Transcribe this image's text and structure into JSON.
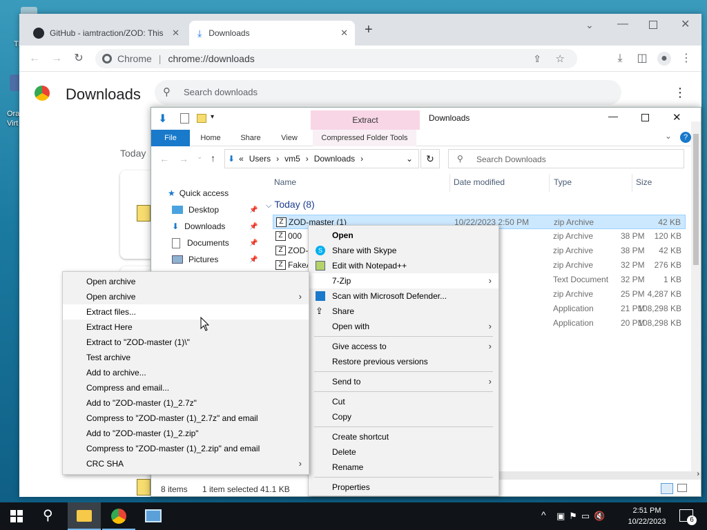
{
  "desktop": {
    "icon1_label": "Th",
    "icon2_label": "Ora\nVirt"
  },
  "browser": {
    "tabs": [
      {
        "title": "GitHub - iamtraction/ZOD: This"
      },
      {
        "title": "Downloads"
      }
    ],
    "new_tab": "+",
    "omnibox": {
      "site": "Chrome",
      "url": "chrome://downloads"
    },
    "page_title": "Downloads",
    "search_placeholder": "Search downloads",
    "section_today": "Today"
  },
  "explorer": {
    "title": "Downloads",
    "context_tab": "Extract",
    "ribbon_tabs": [
      "File",
      "Home",
      "Share",
      "View",
      "Compressed Folder Tools"
    ],
    "breadcrumb": [
      "Users",
      "vm5",
      "Downloads"
    ],
    "breadcrumb_prefix": "«",
    "search_placeholder": "Search Downloads",
    "nav": [
      {
        "label": "Quick access"
      },
      {
        "label": "Desktop"
      },
      {
        "label": "Downloads"
      },
      {
        "label": "Documents"
      },
      {
        "label": "Pictures"
      }
    ],
    "columns": {
      "name": "Name",
      "date": "Date modified",
      "type": "Type",
      "size": "Size"
    },
    "group": "Today (8)",
    "files": [
      {
        "name": "ZOD-master (1)",
        "date": "10/22/2023 2:50 PM",
        "type": "zip Archive",
        "size": "42 KB"
      },
      {
        "name": "000",
        "date": "38 PM",
        "type": "zip Archive",
        "size": "120 KB"
      },
      {
        "name": "ZOD-",
        "date": "38 PM",
        "type": "zip Archive",
        "size": "42 KB"
      },
      {
        "name": "FakeA",
        "date": "32 PM",
        "type": "zip Archive",
        "size": "276 KB"
      },
      {
        "name": "",
        "date": "32 PM",
        "type": "Text Document",
        "size": "1 KB"
      },
      {
        "name": "",
        "date": "25 PM",
        "type": "zip Archive",
        "size": "4,287 KB"
      },
      {
        "name": "",
        "date": "21 PM",
        "type": "Application",
        "size": "108,298 KB"
      },
      {
        "name": "",
        "date": "20 PM",
        "type": "Application",
        "size": "108,298 KB"
      }
    ],
    "status": {
      "items": "8 items",
      "selected": "1 item selected",
      "size": "41.1 KB"
    }
  },
  "context_menu": {
    "items": [
      "Open",
      "Share with Skype",
      "Edit with Notepad++",
      "7-Zip",
      "Scan with Microsoft Defender...",
      "Share",
      "Open with",
      "Give access to",
      "Restore previous versions",
      "Send to",
      "Cut",
      "Copy",
      "Create shortcut",
      "Delete",
      "Rename",
      "Properties"
    ]
  },
  "zip_menu": {
    "items": [
      "Open archive",
      "Open archive",
      "Extract files...",
      "Extract Here",
      "Extract to \"ZOD-master (1)\\\"",
      "Test archive",
      "Add to archive...",
      "Compress and email...",
      "Add to \"ZOD-master (1)_2.7z\"",
      "Compress to \"ZOD-master (1)_2.7z\" and email",
      "Add to \"ZOD-master (1)_2.zip\"",
      "Compress to \"ZOD-master (1)_2.zip\" and email",
      "CRC SHA"
    ]
  },
  "taskbar": {
    "time": "2:51 PM",
    "date": "10/22/2023",
    "notif_count": "6"
  },
  "colors": {
    "accent": "#1a73e8",
    "selection": "#cce8ff",
    "file_tab": "#1979ca",
    "extract_tab": "#f8d6e6"
  }
}
